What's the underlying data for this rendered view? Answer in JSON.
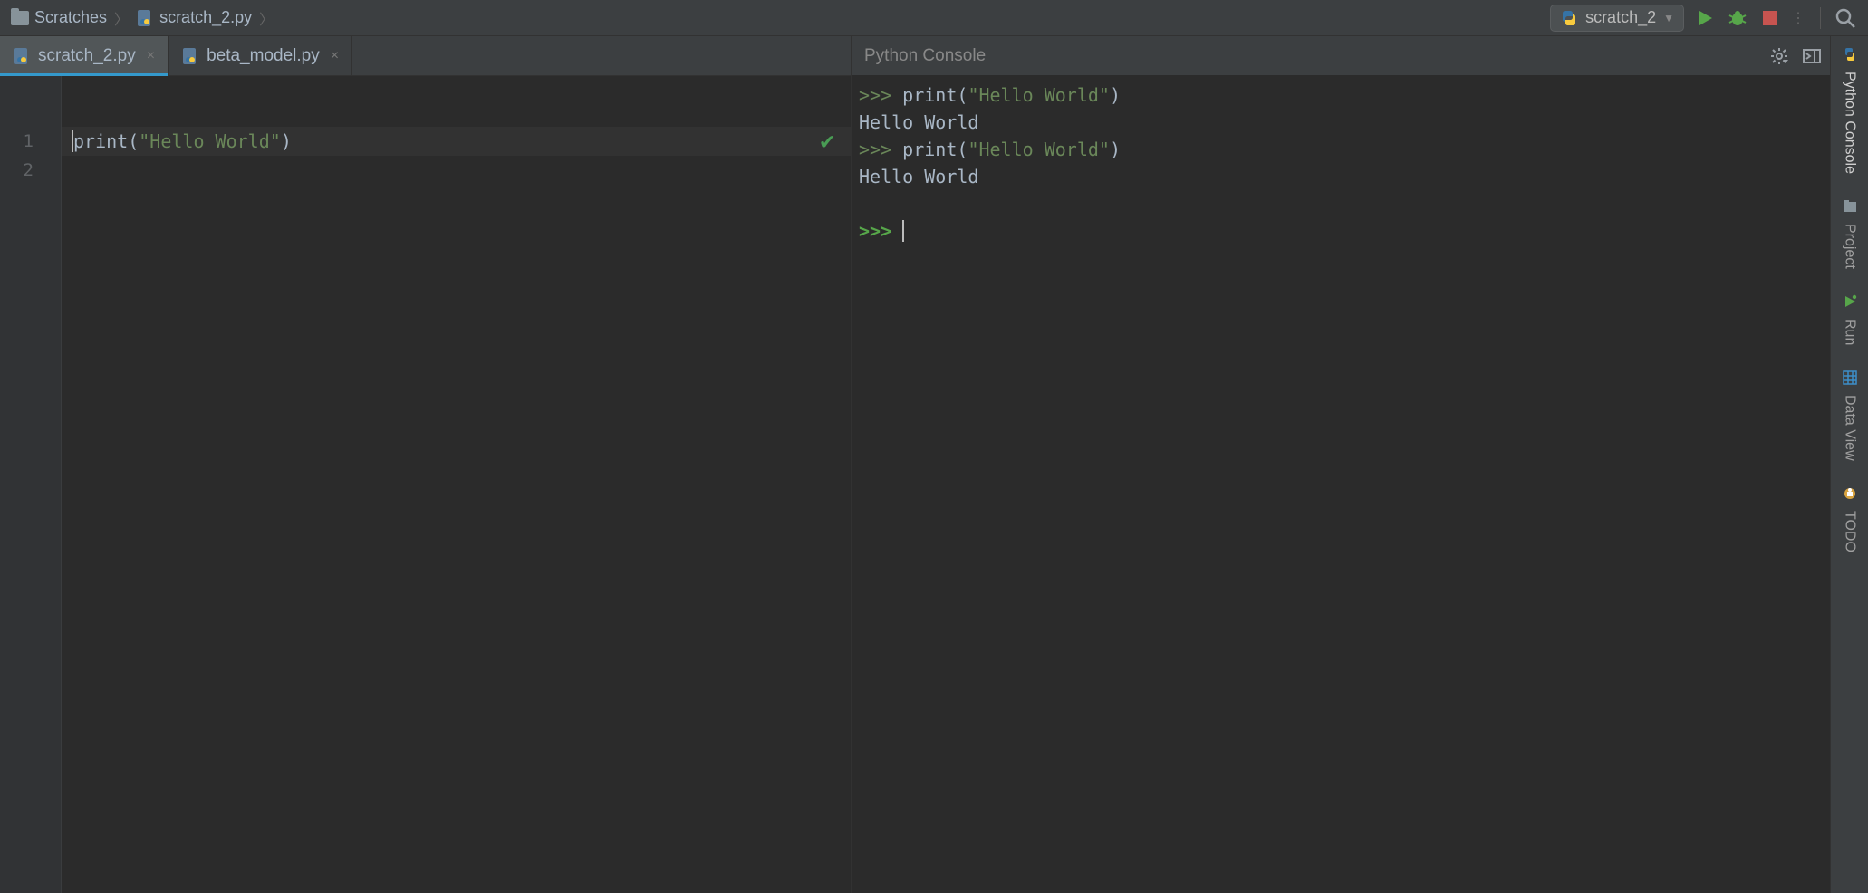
{
  "breadcrumbs": {
    "folder": "Scratches",
    "file": "scratch_2.py"
  },
  "toolbar": {
    "run_config": "scratch_2"
  },
  "editor": {
    "tabs": [
      {
        "label": "scratch_2.py",
        "closeable": true,
        "active": true
      },
      {
        "label": "beta_model.py",
        "closeable": true,
        "active": false
      }
    ],
    "line_numbers": [
      "1",
      "2"
    ],
    "code": {
      "call": "print",
      "string": "\"Hello World\""
    }
  },
  "console": {
    "title": "Python Console",
    "prompt": ">>> ",
    "entries": [
      {
        "type": "input",
        "call": "print",
        "string": "\"Hello World\""
      },
      {
        "type": "output",
        "text": "Hello World"
      },
      {
        "type": "input",
        "call": "print",
        "string": "\"Hello World\""
      },
      {
        "type": "output",
        "text": "Hello World"
      }
    ]
  },
  "toolstrip": {
    "items": [
      {
        "label": "Python Console"
      },
      {
        "label": "Project"
      },
      {
        "label": "Run"
      },
      {
        "label": "Data View"
      },
      {
        "label": "TODO"
      }
    ]
  }
}
